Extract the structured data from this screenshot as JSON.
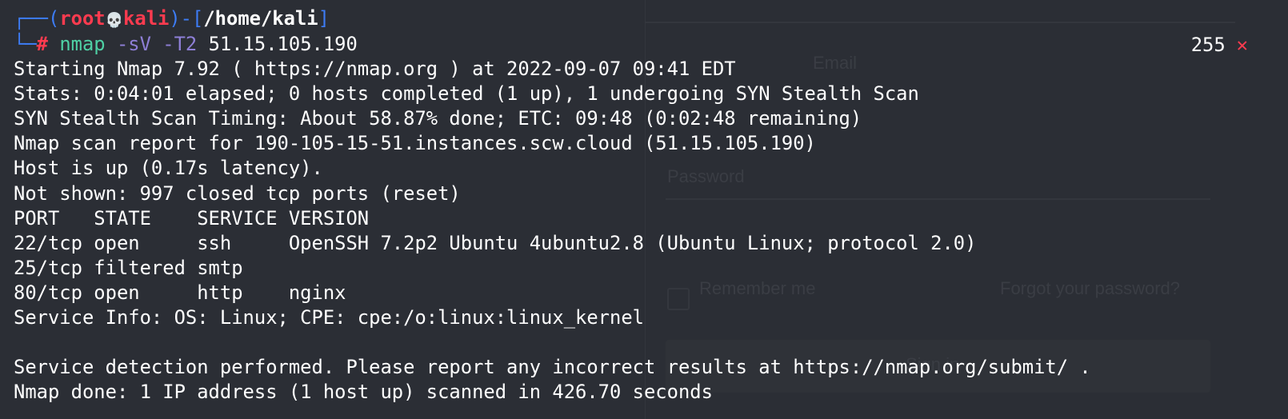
{
  "prompt": {
    "user": "root",
    "skull": "💀",
    "host": "kali",
    "cwd": "/home/kali",
    "symbol": "#",
    "command": "nmap",
    "option1": "-sV",
    "option2": "-T2",
    "target": "51.15.105.190"
  },
  "status": {
    "exit_code": "255",
    "error_mark": "✕"
  },
  "output": [
    "Starting Nmap 7.92 ( https://nmap.org ) at 2022-09-07 09:41 EDT",
    "Stats: 0:04:01 elapsed; 0 hosts completed (1 up), 1 undergoing SYN Stealth Scan",
    "SYN Stealth Scan Timing: About 58.87% done; ETC: 09:48 (0:02:48 remaining)",
    "Nmap scan report for 190-105-15-51.instances.scw.cloud (51.15.105.190)",
    "Host is up (0.17s latency).",
    "Not shown: 997 closed tcp ports (reset)",
    "PORT   STATE    SERVICE VERSION",
    "22/tcp open     ssh     OpenSSH 7.2p2 Ubuntu 4ubuntu2.8 (Ubuntu Linux; protocol 2.0)",
    "25/tcp filtered smtp",
    "80/tcp open     http    nginx",
    "Service Info: OS: Linux; CPE: cpe:/o:linux:linux_kernel",
    "",
    "Service detection performed. Please report any incorrect results at https://nmap.org/submit/ .",
    "Nmap done: 1 IP address (1 host up) scanned in 426.70 seconds"
  ],
  "background_window": {
    "password_label": "Password",
    "remember_label": "Remember me",
    "forgot_link": "Forgot your password?",
    "signin_label": "Sign in",
    "email_label": "Email"
  },
  "colors": {
    "background": "#2b2e35",
    "prompt_frame": "#3d7cf5",
    "prompt_user": "#ff3b4f",
    "command": "#4fd1a5",
    "option": "#8e7fd6",
    "error": "#ff3b4f"
  }
}
